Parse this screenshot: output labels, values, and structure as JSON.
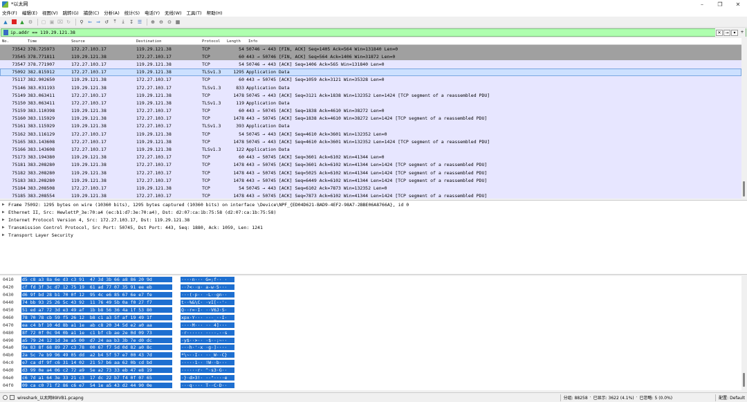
{
  "window": {
    "title": "*以太网"
  },
  "menu": [
    "文件(F)",
    "编辑(E)",
    "视图(V)",
    "跳转(G)",
    "捕获(C)",
    "分析(A)",
    "统计(S)",
    "电话(Y)",
    "无线(W)",
    "工具(T)",
    "帮助(H)"
  ],
  "filter": {
    "value": "ip.addr == 119.29.121.38"
  },
  "columns": {
    "no": "No.",
    "time": "Time",
    "source": "Source",
    "destination": "Destination",
    "protocol": "Protocol",
    "length": "Length",
    "info": "Info"
  },
  "packets": [
    {
      "no": "73542",
      "time": "378.725973",
      "src": "172.27.103.17",
      "dst": "119.29.121.38",
      "proto": "TCP",
      "len": "54",
      "info": "50746 → 443 [FIN, ACK] Seq=1405 Ack=564 Win=131840 Len=0",
      "style": "grey"
    },
    {
      "no": "73545",
      "time": "378.771811",
      "src": "119.29.121.38",
      "dst": "172.27.103.17",
      "proto": "TCP",
      "len": "60",
      "info": "443 → 50746 [FIN, ACK] Seq=564 Ack=1406 Win=31872 Len=0",
      "style": "grey"
    },
    {
      "no": "73547",
      "time": "378.771907",
      "src": "172.27.103.17",
      "dst": "119.29.121.38",
      "proto": "TCP",
      "len": "54",
      "info": "50746 → 443 [ACK] Seq=1406 Ack=565 Win=131840 Len=0",
      "style": "lav"
    },
    {
      "no": "75092",
      "time": "382.815912",
      "src": "172.27.103.17",
      "dst": "119.29.121.38",
      "proto": "TLSv1.3",
      "len": "1295",
      "info": "Application Data",
      "style": "sel"
    },
    {
      "no": "75117",
      "time": "382.902650",
      "src": "119.29.121.38",
      "dst": "172.27.103.17",
      "proto": "TCP",
      "len": "60",
      "info": "443 → 50745 [ACK] Seq=1059 Ack=3121 Win=35328 Len=0",
      "style": "lav"
    },
    {
      "no": "75146",
      "time": "383.031193",
      "src": "119.29.121.38",
      "dst": "172.27.103.17",
      "proto": "TLSv1.3",
      "len": "833",
      "info": "Application Data",
      "style": "lav"
    },
    {
      "no": "75149",
      "time": "383.063411",
      "src": "172.27.103.17",
      "dst": "119.29.121.38",
      "proto": "TCP",
      "len": "1478",
      "info": "50745 → 443 [ACK] Seq=3121 Ack=1838 Win=132352 Len=1424 [TCP segment of a reassembled PDU]",
      "style": "lav"
    },
    {
      "no": "75150",
      "time": "383.063411",
      "src": "172.27.103.17",
      "dst": "119.29.121.38",
      "proto": "TLSv1.3",
      "len": "119",
      "info": "Application Data",
      "style": "lav"
    },
    {
      "no": "75159",
      "time": "383.110398",
      "src": "119.29.121.38",
      "dst": "172.27.103.17",
      "proto": "TCP",
      "len": "60",
      "info": "443 → 50745 [ACK] Seq=1838 Ack=4610 Win=38272 Len=0",
      "style": "lav"
    },
    {
      "no": "75160",
      "time": "383.115929",
      "src": "119.29.121.38",
      "dst": "172.27.103.17",
      "proto": "TCP",
      "len": "1478",
      "info": "443 → 50745 [ACK] Seq=1838 Ack=4610 Win=38272 Len=1424 [TCP segment of a reassembled PDU]",
      "style": "lav"
    },
    {
      "no": "75161",
      "time": "383.115929",
      "src": "119.29.121.38",
      "dst": "172.27.103.17",
      "proto": "TLSv1.3",
      "len": "393",
      "info": "Application Data",
      "style": "lav"
    },
    {
      "no": "75162",
      "time": "383.116129",
      "src": "172.27.103.17",
      "dst": "119.29.121.38",
      "proto": "TCP",
      "len": "54",
      "info": "50745 → 443 [ACK] Seq=4610 Ack=3601 Win=132352 Len=0",
      "style": "lav"
    },
    {
      "no": "75165",
      "time": "383.143608",
      "src": "172.27.103.17",
      "dst": "119.29.121.38",
      "proto": "TCP",
      "len": "1478",
      "info": "50745 → 443 [ACK] Seq=4610 Ack=3601 Win=132352 Len=1424 [TCP segment of a reassembled PDU]",
      "style": "lav"
    },
    {
      "no": "75166",
      "time": "383.143608",
      "src": "172.27.103.17",
      "dst": "119.29.121.38",
      "proto": "TLSv1.3",
      "len": "122",
      "info": "Application Data",
      "style": "lav"
    },
    {
      "no": "75173",
      "time": "383.194380",
      "src": "119.29.121.38",
      "dst": "172.27.103.17",
      "proto": "TCP",
      "len": "60",
      "info": "443 → 50745 [ACK] Seq=3601 Ack=6102 Win=41344 Len=0",
      "style": "lav"
    },
    {
      "no": "75181",
      "time": "383.208280",
      "src": "119.29.121.38",
      "dst": "172.27.103.17",
      "proto": "TCP",
      "len": "1478",
      "info": "443 → 50745 [ACK] Seq=3601 Ack=6102 Win=41344 Len=1424 [TCP segment of a reassembled PDU]",
      "style": "lav"
    },
    {
      "no": "75182",
      "time": "383.208280",
      "src": "119.29.121.38",
      "dst": "172.27.103.17",
      "proto": "TCP",
      "len": "1478",
      "info": "443 → 50745 [ACK] Seq=5025 Ack=6102 Win=41344 Len=1424 [TCP segment of a reassembled PDU]",
      "style": "lav"
    },
    {
      "no": "75183",
      "time": "383.208280",
      "src": "119.29.121.38",
      "dst": "172.27.103.17",
      "proto": "TCP",
      "len": "1478",
      "info": "443 → 50745 [ACK] Seq=6449 Ack=6102 Win=41344 Len=1424 [TCP segment of a reassembled PDU]",
      "style": "lav"
    },
    {
      "no": "75184",
      "time": "383.208508",
      "src": "172.27.103.17",
      "dst": "119.29.121.38",
      "proto": "TCP",
      "len": "54",
      "info": "50745 → 443 [ACK] Seq=6102 Ack=7873 Win=132352 Len=0",
      "style": "lav"
    },
    {
      "no": "75185",
      "time": "383.208554",
      "src": "119.29.121.38",
      "dst": "172.27.103.17",
      "proto": "TCP",
      "len": "1478",
      "info": "443 → 50745 [ACK] Seq=7873 Ack=6102 Win=41344 Len=1424 [TCP segment of a reassembled PDU]",
      "style": "lav"
    }
  ],
  "details": [
    "Frame 75092: 1295 bytes on wire (10360 bits), 1295 bytes captured (10360 bits) on interface \\Device\\NPF_{ED04D621-BAD9-4EF2-98A7-2BBE06A8766A}, id 0",
    "Ethernet II, Src: HewlettP_3e:70:a4 (ec:b1:d7:3e:70:a4), Dst: d2:07:ca:1b:75:58 (d2:07:ca:1b:75:58)",
    "Internet Protocol Version 4, Src: 172.27.103.17, Dst: 119.29.121.38",
    "Transmission Control Protocol, Src Port: 50745, Dst Port: 443, Seq: 1880, Ack: 1059, Len: 1241",
    "Transport Layer Security"
  ],
  "bytes": [
    {
      "off": "0410",
      "hex": "d5 c8 a3 8a 6e d3 c3 91  47 3d 3b 66 a8 86 20 9d",
      "ascii": "····n··· G=;f·· ·"
    },
    {
      "off": "0420",
      "hex": "cf fd 3f 3c d7 12 75 19  61 ad 77 07 35 91 ee eb",
      "ascii": "··?<··u· a-w·5···"
    },
    {
      "off": "0430",
      "hex": "d6 9f bd 28 b1 70 0f 12  95 4c e6 85 67 6e e7 fe",
      "ascii": "···(·p·· ·L··gn··"
    },
    {
      "off": "0440",
      "hex": "74 bb 93 25 26 5c 43 92  11 76 49 5b 0a f0 27 f7",
      "ascii": "t··%&\\C· ·vI[··'·"
    },
    {
      "off": "0450",
      "hex": "51 ed a7 72 3d e3 49 af  1b b8 56 36 4a 1f 53 80",
      "ascii": "Q··r=·I· ··V6J·S·"
    },
    {
      "off": "0460",
      "hex": "78 70 78 cb 59 f5 26 12  b8 c1 a3 5f af 19 49 1f",
      "ascii": "xpx·Y··· ···_··I·"
    },
    {
      "off": "0470",
      "hex": "ea c4 bf 10 4d 8b a1 1e  ab c8 20 34 5d e2 a0 aa",
      "ascii": "····M··· ·· 4]···"
    },
    {
      "off": "0480",
      "hex": "8f 72 0f 0c 94 0b a1 1e  c1 bf cb ae 2e 0d 09 73",
      "ascii": "·r······ ····.··s"
    },
    {
      "off": "0490",
      "hex": "a5 79 24 12 1d 3e a5 00  d7 24 aa b3 3b 7e d0 dc",
      "ascii": "·y$··>·· ·$··;~··"
    },
    {
      "off": "04a0",
      "hex": "9a 83 8f 68 89 27 c3 78  00 67 f7 5d 0d 82 a0 8c",
      "ascii": "···h·'·x ·g·]····"
    },
    {
      "off": "04b0",
      "hex": "2a 5c 7e b9 96 49 05 dd  a2 b4 5f 57 e7 00 43 7d",
      "ascii": "*\\~··I·· ··_W··C}"
    },
    {
      "off": "04c0",
      "hex": "e7 ca df 9f c6 31 14 02  21 57 b6 aa 62 0b cd bd",
      "ascii": "·····1·· !W··b···"
    },
    {
      "off": "04d0",
      "hex": "d3 99 0e a4 06 c2 72 a9  5e a2 73 33 eb 47 e8 19",
      "ascii": "······r· ^·s3·G··"
    },
    {
      "off": "04e0",
      "hex": "c6 7d a1 64 3e 33 21 c3  17 dc 22 b7 f4 0f 07 65",
      "ascii": "·}·d>3!· ··\"····e"
    },
    {
      "off": "04f0",
      "hex": "09 ca c0 71 f2 86 c6 e7  54 1e a5 43 d2 44 90 0e",
      "ascii": "···q···· T··C·D··"
    },
    {
      "off": "0500",
      "hex": "ae b9 29 c5 9f fb af 0c  ba 18 42 d5 22 7d 6f",
      "ascii": "··)····· ··B·\"}o"
    }
  ],
  "status": {
    "file": "wireshark_以太网89IVB1.pcapng",
    "packets": "分组: 88258",
    "displayed": "已显示: 3622 (4.1%)",
    "ignored": "已忽略: 5 (0.0%)",
    "profile": "配置: Default"
  }
}
